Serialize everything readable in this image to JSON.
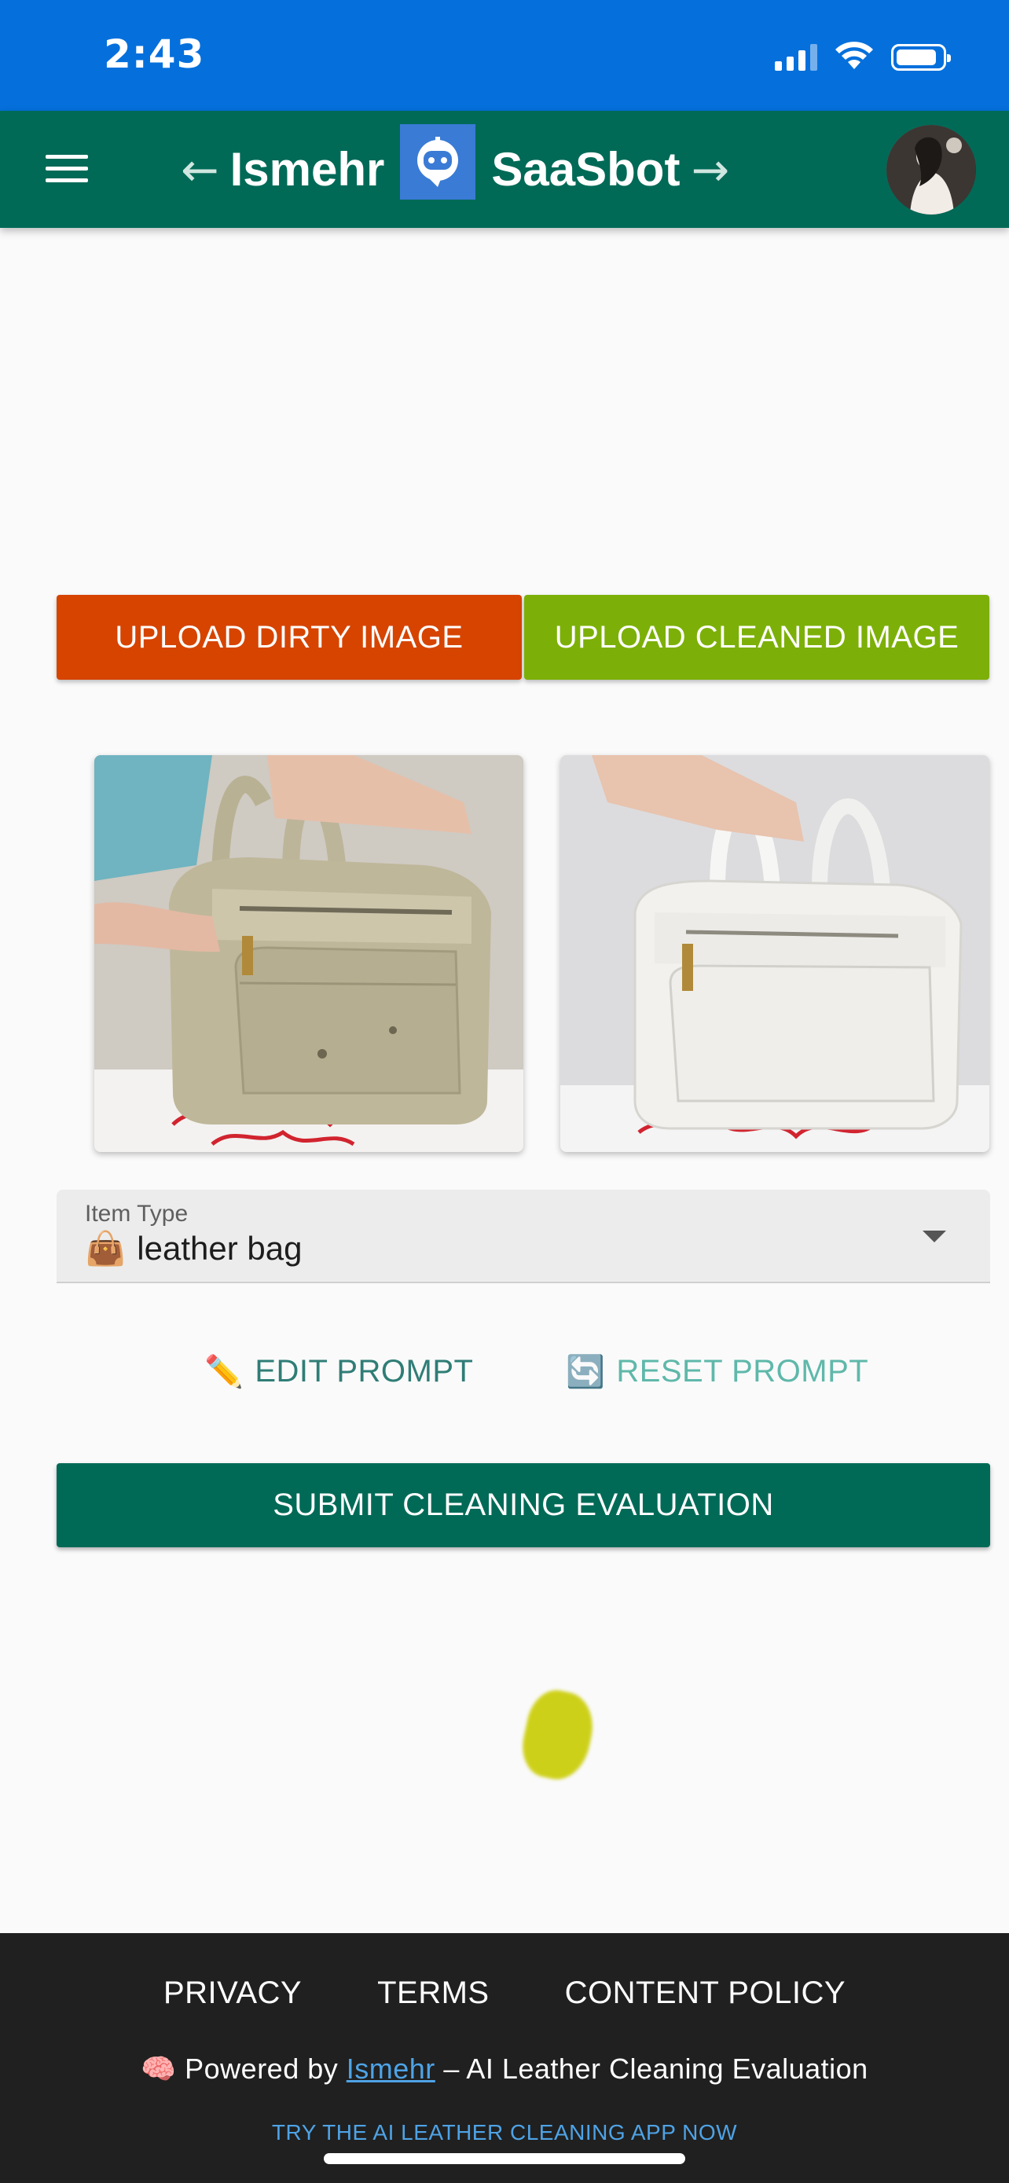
{
  "status_bar": {
    "time": "2:43"
  },
  "app_bar": {
    "brand_left": "Ismehr",
    "brand_right": "SaaSbot",
    "back_arrow": "←",
    "forward_arrow": "→"
  },
  "uploads": {
    "dirty_label": "UPLOAD DIRTY IMAGE",
    "clean_label": "UPLOAD CLEANED IMAGE"
  },
  "item_type": {
    "label": "Item Type",
    "value_emoji": "👜",
    "value": "leather bag"
  },
  "prompt_actions": {
    "edit_emoji": "✏️",
    "edit_label": "EDIT PROMPT",
    "reset_emoji": "🔄",
    "reset_label": "RESET PROMPT"
  },
  "submit_label": "SUBMIT CLEANING EVALUATION",
  "footer": {
    "links": [
      "PRIVACY",
      "TERMS",
      "CONTENT POLICY"
    ],
    "powered_emoji": "🧠",
    "powered_prefix": "Powered by",
    "powered_link": "Ismehr",
    "powered_suffix": "– AI Leather Cleaning Evaluation",
    "cta": "TRY THE AI LEATHER CLEANING APP NOW"
  },
  "colors": {
    "status_bar": "#0570dc",
    "app_bar": "#006a57",
    "upload_dirty": "#d64400",
    "upload_clean": "#7cb008",
    "submit": "#006a57",
    "link": "#4ea3e6"
  }
}
